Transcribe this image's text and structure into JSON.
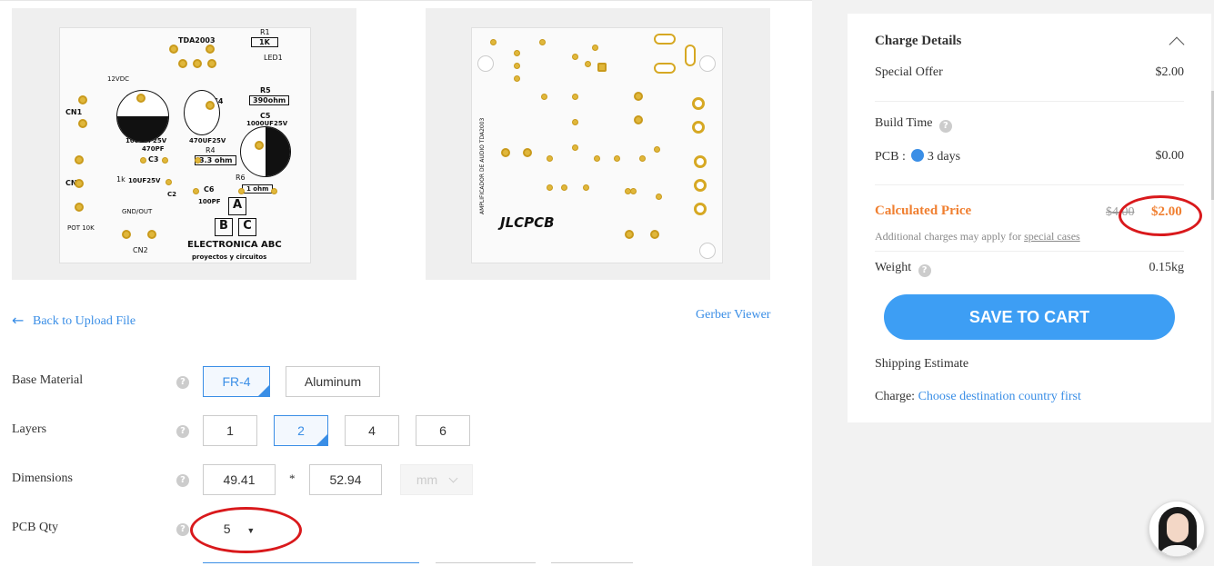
{
  "preview": {
    "top_board": {
      "labels": [
        "TDA2003",
        "R1",
        "1K",
        "LED1",
        "C1",
        "C4",
        "R5",
        "390ohm",
        "C5",
        "1000UF25V",
        "470UF25V",
        "1000UF25V",
        "R4",
        "3.3 ohm",
        "C3",
        "470PF",
        "R6",
        "1 ohm",
        "C6",
        "100PF",
        "10UF25V",
        "C2",
        "1k",
        "GND/OUT",
        "CN1",
        "CN2",
        "CN3",
        "POT 10K",
        "12VDC",
        "ELECTRONICA ABC",
        "proyectos y circuitos",
        "A",
        "B",
        "C"
      ]
    },
    "bottom_board": {
      "vertical_text": "AMPLIFICADOR DE AUDIO TDA2003",
      "logo": "JLCPCB"
    }
  },
  "nav": {
    "back_arrow": "←",
    "back_label": "Back to Upload File",
    "gerber_viewer": "Gerber Viewer"
  },
  "form": {
    "base_material": {
      "label": "Base Material",
      "options": [
        "FR-4",
        "Aluminum"
      ],
      "selected": "FR-4"
    },
    "layers": {
      "label": "Layers",
      "options": [
        "1",
        "2",
        "4",
        "6"
      ],
      "selected": "2"
    },
    "dimensions": {
      "label": "Dimensions",
      "width": "49.41",
      "separator": "*",
      "height": "52.94",
      "unit": "mm"
    },
    "pcb_qty": {
      "label": "PCB Qty",
      "value": "5"
    },
    "help_glyph": "?"
  },
  "charge": {
    "title": "Charge Details",
    "special_offer": {
      "label": "Special Offer",
      "value": "$2.00"
    },
    "build_time": {
      "label": "Build Time"
    },
    "pcb": {
      "label": "PCB :",
      "days": "3 days",
      "value": "$0.00"
    },
    "calculated": {
      "label": "Calculated Price",
      "old": "$4.00",
      "new": "$2.00"
    },
    "note": {
      "text": "Additional charges may apply for ",
      "link": "special cases"
    },
    "weight": {
      "label": "Weight",
      "value": "0.15kg"
    },
    "cart_button": "SAVE TO CART",
    "shipping": {
      "label": "Shipping Estimate",
      "charge_label": "Charge:",
      "charge_link": "Choose destination country first"
    }
  },
  "colors": {
    "accent": "#3a8ee6",
    "price": "#f07f30",
    "cart": "#3d9ef4",
    "annotation": "#d9191c",
    "pad": "#e0b73b"
  },
  "icons": [
    "arrow-left-icon",
    "help-icon",
    "chevron-up-icon",
    "caret-down-icon",
    "selected-corner-icon"
  ]
}
